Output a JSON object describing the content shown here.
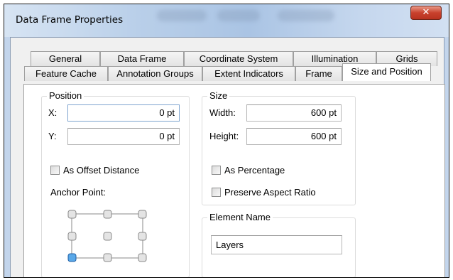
{
  "window": {
    "title": "Data Frame Properties",
    "close_glyph": "✕"
  },
  "tabs": {
    "row1": [
      "General",
      "Data Frame",
      "Coordinate System",
      "Illumination",
      "Grids"
    ],
    "row2": [
      "Feature Cache",
      "Annotation Groups",
      "Extent Indicators",
      "Frame",
      "Size and Position"
    ],
    "active": "Size and Position"
  },
  "position": {
    "title": "Position",
    "x_label": "X:",
    "x_value": "0 pt",
    "y_label": "Y:",
    "y_value": "0 pt",
    "offset_label": "As Offset Distance",
    "offset_checked": false,
    "anchor_label": "Anchor Point:",
    "anchor_selected": "bottom-left"
  },
  "size": {
    "title": "Size",
    "width_label": "Width:",
    "width_value": "600 pt",
    "height_label": "Height:",
    "height_value": "600 pt",
    "percentage_label": "As Percentage",
    "percentage_checked": false,
    "aspect_label": "Preserve Aspect Ratio",
    "aspect_checked": false
  },
  "element_name": {
    "title": "Element Name",
    "value": "Layers"
  },
  "colors": {
    "title_bar": "#b9cfe9",
    "close_button": "#c8412d",
    "anchor_selected": "#3d8fd9"
  }
}
